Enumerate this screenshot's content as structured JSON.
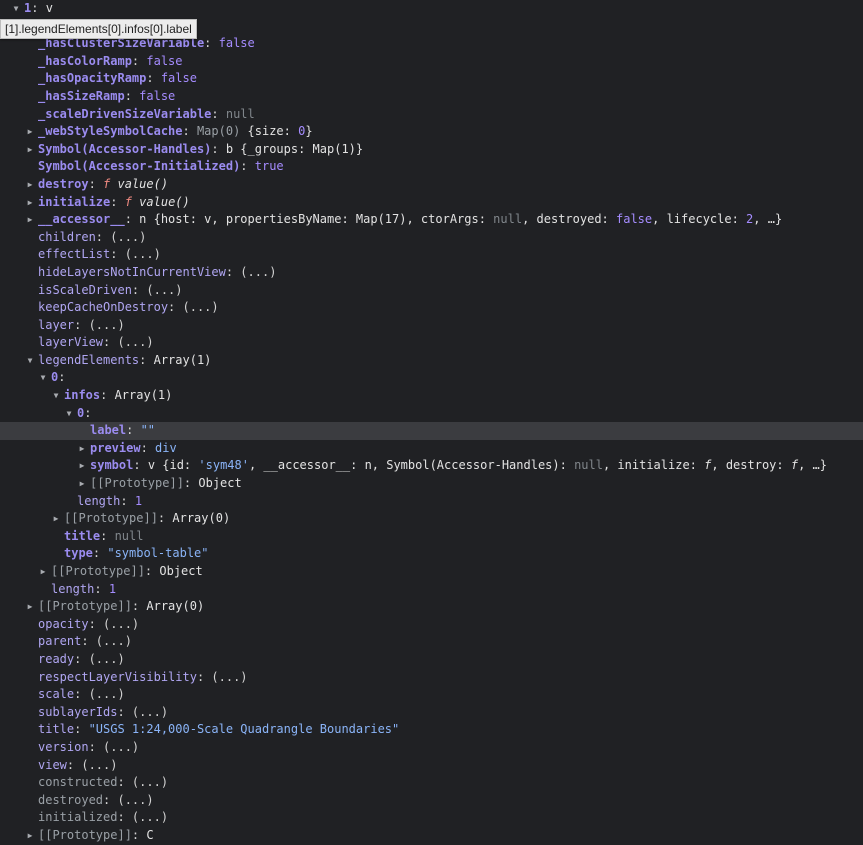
{
  "tooltip": "[1].legendElements[0].infos[0].label",
  "rows": [
    {
      "tri": "open",
      "segs": [
        [
          "k",
          "1"
        ],
        [
          "p",
          ": "
        ],
        [
          "v",
          "v"
        ]
      ]
    },
    {
      "tri": "",
      "segs": [
        [
          "grey",
          "ap(0) "
        ],
        [
          "v",
          "{size: "
        ],
        [
          "num",
          "0"
        ],
        [
          "v",
          "}"
        ]
      ]
    },
    {
      "tri": "",
      "segs": [
        [
          "k",
          "_hasClusterSizeVariable"
        ],
        [
          "p",
          ": "
        ],
        [
          "bool",
          "false"
        ]
      ]
    },
    {
      "tri": "",
      "segs": [
        [
          "k",
          "_hasColorRamp"
        ],
        [
          "p",
          ": "
        ],
        [
          "bool",
          "false"
        ]
      ]
    },
    {
      "tri": "",
      "segs": [
        [
          "k",
          "_hasOpacityRamp"
        ],
        [
          "p",
          ": "
        ],
        [
          "bool",
          "false"
        ]
      ]
    },
    {
      "tri": "",
      "segs": [
        [
          "k",
          "_hasSizeRamp"
        ],
        [
          "p",
          ": "
        ],
        [
          "bool",
          "false"
        ]
      ]
    },
    {
      "tri": "",
      "segs": [
        [
          "k",
          "_scaleDrivenSizeVariable"
        ],
        [
          "p",
          ": "
        ],
        [
          "nul",
          "null"
        ]
      ]
    },
    {
      "tri": "closed",
      "segs": [
        [
          "k",
          "_webStyleSymbolCache"
        ],
        [
          "p",
          ": "
        ],
        [
          "grey",
          "Map(0) "
        ],
        [
          "v",
          "{size: "
        ],
        [
          "num",
          "0"
        ],
        [
          "v",
          "}"
        ]
      ]
    },
    {
      "tri": "closed",
      "segs": [
        [
          "k",
          "Symbol(Accessor-Handles)"
        ],
        [
          "p",
          ": "
        ],
        [
          "v",
          "b {_groups: Map(1)}"
        ]
      ]
    },
    {
      "tri": "",
      "segs": [
        [
          "k",
          "Symbol(Accessor-Initialized)"
        ],
        [
          "p",
          ": "
        ],
        [
          "bool",
          "true"
        ]
      ]
    },
    {
      "tri": "closed",
      "segs": [
        [
          "k",
          "destroy"
        ],
        [
          "p",
          ": "
        ],
        [
          "fn",
          "f"
        ],
        [
          "v",
          " "
        ],
        [
          "ital",
          "value()"
        ]
      ]
    },
    {
      "tri": "closed",
      "segs": [
        [
          "k",
          "initialize"
        ],
        [
          "p",
          ": "
        ],
        [
          "fn",
          "f"
        ],
        [
          "v",
          " "
        ],
        [
          "ital",
          "value()"
        ]
      ]
    },
    {
      "tri": "closed",
      "segs": [
        [
          "k",
          "__accessor__"
        ],
        [
          "p",
          ": "
        ],
        [
          "v",
          "n {host: v, propertiesByName: Map(17), ctorArgs: "
        ],
        [
          "nul",
          "null"
        ],
        [
          "v",
          ", destroyed: "
        ],
        [
          "bool",
          "false"
        ],
        [
          "v",
          ", lifecycle: "
        ],
        [
          "num",
          "2"
        ],
        [
          "v",
          ", …}"
        ]
      ]
    },
    {
      "tri": "",
      "segs": [
        [
          "k inh",
          "children"
        ],
        [
          "p",
          ": (...)"
        ]
      ]
    },
    {
      "tri": "",
      "segs": [
        [
          "k inh",
          "effectList"
        ],
        [
          "p",
          ": (...)"
        ]
      ]
    },
    {
      "tri": "",
      "segs": [
        [
          "k inh",
          "hideLayersNotInCurrentView"
        ],
        [
          "p",
          ": (...)"
        ]
      ]
    },
    {
      "tri": "",
      "segs": [
        [
          "k inh",
          "isScaleDriven"
        ],
        [
          "p",
          ": (...)"
        ]
      ]
    },
    {
      "tri": "",
      "segs": [
        [
          "k inh",
          "keepCacheOnDestroy"
        ],
        [
          "p",
          ": (...)"
        ]
      ]
    },
    {
      "tri": "",
      "segs": [
        [
          "k inh",
          "layer"
        ],
        [
          "p",
          ": (...)"
        ]
      ]
    },
    {
      "tri": "",
      "segs": [
        [
          "k inh",
          "layerView"
        ],
        [
          "p",
          ": (...)"
        ]
      ]
    },
    {
      "tri": "open",
      "segs": [
        [
          "k inh",
          "legendElements"
        ],
        [
          "p",
          ": "
        ],
        [
          "v",
          "Array(1)"
        ]
      ]
    },
    {
      "tri": "open",
      "segs": [
        [
          "k",
          "0"
        ],
        [
          "p",
          ":"
        ]
      ]
    },
    {
      "tri": "open",
      "segs": [
        [
          "k",
          "infos"
        ],
        [
          "p",
          ": "
        ],
        [
          "v",
          "Array(1)"
        ]
      ]
    },
    {
      "tri": "open",
      "segs": [
        [
          "k",
          "0"
        ],
        [
          "p",
          ":"
        ]
      ]
    },
    {
      "tri": "",
      "segs": [
        [
          "k",
          "label"
        ],
        [
          "p",
          ": "
        ],
        [
          "str",
          "\"\""
        ]
      ]
    },
    {
      "tri": "closed",
      "segs": [
        [
          "k",
          "preview"
        ],
        [
          "p",
          ": "
        ],
        [
          "str",
          "div"
        ]
      ]
    },
    {
      "tri": "closed",
      "segs": [
        [
          "k",
          "symbol"
        ],
        [
          "p",
          ": "
        ],
        [
          "v",
          "v {id: "
        ],
        [
          "str",
          "'sym48'"
        ],
        [
          "v",
          ", __accessor__: n, Symbol(Accessor-Handles): "
        ],
        [
          "nul",
          "null"
        ],
        [
          "v",
          ", initialize: "
        ],
        [
          "ital",
          "f"
        ],
        [
          "v",
          ", destroy: "
        ],
        [
          "ital",
          "f"
        ],
        [
          "v",
          ", …}"
        ]
      ]
    },
    {
      "tri": "closed",
      "segs": [
        [
          "grey",
          "[[Prototype]]"
        ],
        [
          "p",
          ": "
        ],
        [
          "v",
          "Object"
        ]
      ]
    },
    {
      "tri": "",
      "segs": [
        [
          "k inh",
          "length"
        ],
        [
          "p",
          ": "
        ],
        [
          "num",
          "1"
        ]
      ]
    },
    {
      "tri": "closed",
      "segs": [
        [
          "grey",
          "[[Prototype]]"
        ],
        [
          "p",
          ": "
        ],
        [
          "v",
          "Array(0)"
        ]
      ]
    },
    {
      "tri": "",
      "segs": [
        [
          "k",
          "title"
        ],
        [
          "p",
          ": "
        ],
        [
          "nul",
          "null"
        ]
      ]
    },
    {
      "tri": "",
      "segs": [
        [
          "k",
          "type"
        ],
        [
          "p",
          ": "
        ],
        [
          "str",
          "\"symbol-table\""
        ]
      ]
    },
    {
      "tri": "closed",
      "segs": [
        [
          "grey",
          "[[Prototype]]"
        ],
        [
          "p",
          ": "
        ],
        [
          "v",
          "Object"
        ]
      ]
    },
    {
      "tri": "",
      "segs": [
        [
          "k inh",
          "length"
        ],
        [
          "p",
          ": "
        ],
        [
          "num",
          "1"
        ]
      ]
    },
    {
      "tri": "closed",
      "segs": [
        [
          "grey",
          "[[Prototype]]"
        ],
        [
          "p",
          ": "
        ],
        [
          "v",
          "Array(0)"
        ]
      ]
    },
    {
      "tri": "",
      "segs": [
        [
          "k inh",
          "opacity"
        ],
        [
          "p",
          ": (...)"
        ]
      ]
    },
    {
      "tri": "",
      "segs": [
        [
          "k inh",
          "parent"
        ],
        [
          "p",
          ": (...)"
        ]
      ]
    },
    {
      "tri": "",
      "segs": [
        [
          "k inh",
          "ready"
        ],
        [
          "p",
          ": (...)"
        ]
      ]
    },
    {
      "tri": "",
      "segs": [
        [
          "k inh",
          "respectLayerVisibility"
        ],
        [
          "p",
          ": (...)"
        ]
      ]
    },
    {
      "tri": "",
      "segs": [
        [
          "k inh",
          "scale"
        ],
        [
          "p",
          ": (...)"
        ]
      ]
    },
    {
      "tri": "",
      "segs": [
        [
          "k inh",
          "sublayerIds"
        ],
        [
          "p",
          ": (...)"
        ]
      ]
    },
    {
      "tri": "",
      "segs": [
        [
          "k inh",
          "title"
        ],
        [
          "p",
          ": "
        ],
        [
          "str",
          "\"USGS 1:24,000-Scale Quadrangle Boundaries\""
        ]
      ]
    },
    {
      "tri": "",
      "segs": [
        [
          "k inh",
          "version"
        ],
        [
          "p",
          ": (...)"
        ]
      ]
    },
    {
      "tri": "",
      "segs": [
        [
          "k inh",
          "view"
        ],
        [
          "p",
          ": (...)"
        ]
      ]
    },
    {
      "tri": "",
      "segs": [
        [
          "grey",
          "constructed"
        ],
        [
          "p",
          ": (...)"
        ]
      ]
    },
    {
      "tri": "",
      "segs": [
        [
          "grey",
          "destroyed"
        ],
        [
          "p",
          ": (...)"
        ]
      ]
    },
    {
      "tri": "",
      "segs": [
        [
          "grey",
          "initialized"
        ],
        [
          "p",
          ": (...)"
        ]
      ]
    },
    {
      "tri": "closed",
      "segs": [
        [
          "grey",
          "[[Prototype]]"
        ],
        [
          "p",
          ": "
        ],
        [
          "v",
          "C"
        ]
      ]
    }
  ]
}
